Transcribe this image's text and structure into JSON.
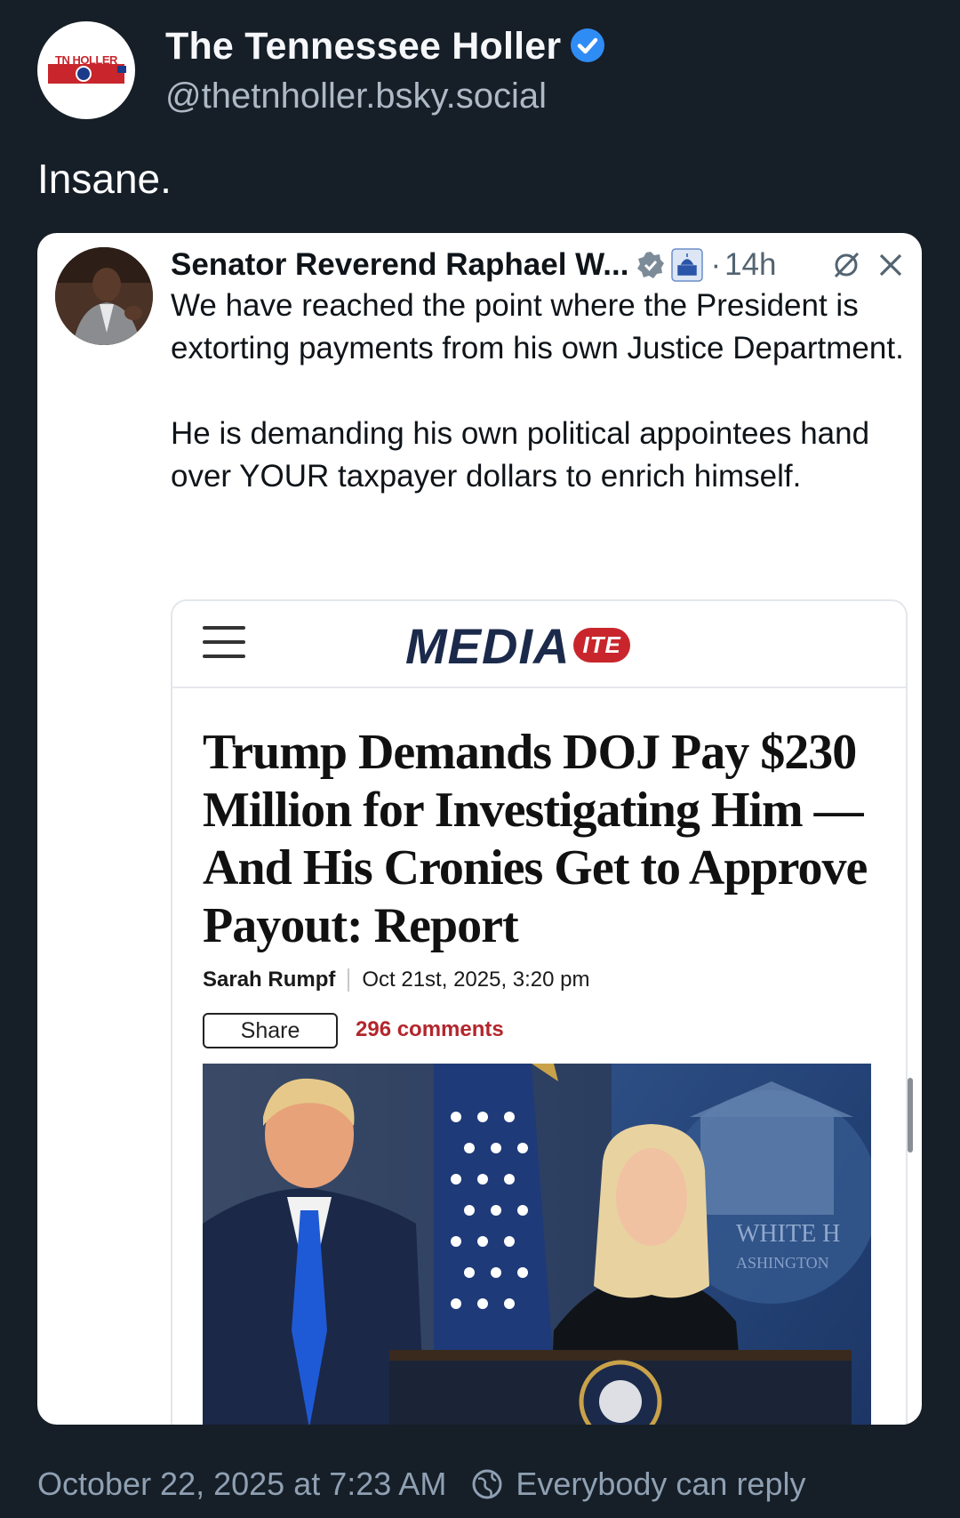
{
  "post": {
    "display_name": "The Tennessee Holler",
    "handle": "@thetnholler.bsky.social",
    "avatar_logo_text": "TN HOLLER",
    "text": "Insane.",
    "timestamp": "October 22, 2025 at 7:23 AM",
    "reply_setting": "Everybody can reply"
  },
  "embedded_tweet": {
    "author": "Senator Reverend Raphael W...",
    "time_sep": "·",
    "age": "14h",
    "paragraphs": [
      "We have reached the point where the President is extorting payments from his own Justice Department.",
      "He is demanding his own political appointees hand over YOUR taxpayer dollars to enrich himself."
    ]
  },
  "article": {
    "brand": "MEDIA",
    "brand_badge": "ITE",
    "headline": "Trump Demands DOJ Pay $230 Million for Investigating Him — And His Cronies Get to Approve Payout: Report",
    "author": "Sarah Rumpf",
    "date": "Oct 21st, 2025, 3:20 pm",
    "share_label": "Share",
    "comments": "296 comments",
    "photo_sign_text": "WHITE H",
    "photo_sign_sub": "ASHINGTON"
  },
  "colors": {
    "background": "#161e27",
    "verified": "#2f8cf5",
    "comments": "#b3262c",
    "brand_navy": "#1b2a4a",
    "brand_red": "#c8262c"
  }
}
